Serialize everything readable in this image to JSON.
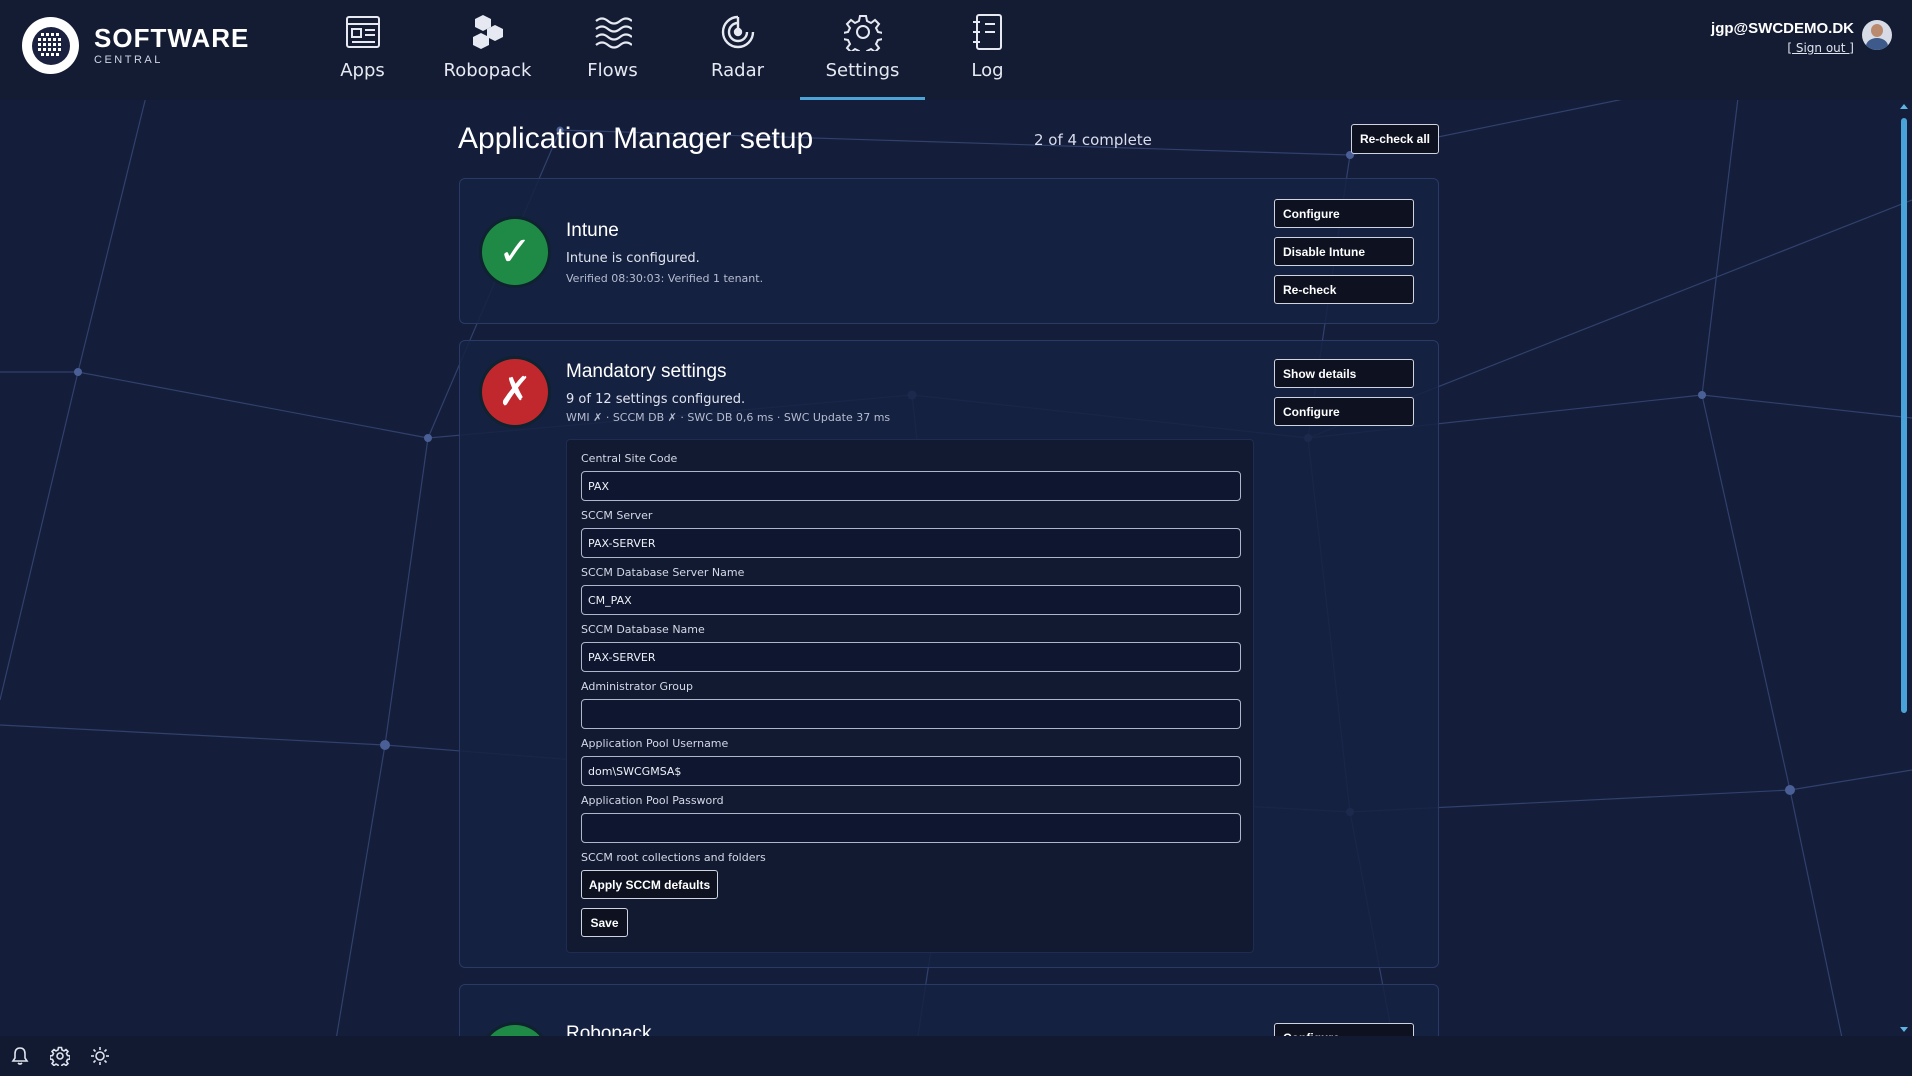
{
  "app": {
    "logo_word": "SOFTWARE",
    "logo_sub": "CENTRAL"
  },
  "nav": {
    "items": [
      {
        "label": "Apps",
        "icon": "apps-icon",
        "active": false
      },
      {
        "label": "Robopack",
        "icon": "robopack-icon",
        "active": false
      },
      {
        "label": "Flows",
        "icon": "flows-icon",
        "active": false
      },
      {
        "label": "Radar",
        "icon": "radar-icon",
        "active": false
      },
      {
        "label": "Settings",
        "icon": "gear-icon",
        "active": true
      },
      {
        "label": "Log",
        "icon": "log-icon",
        "active": false
      }
    ]
  },
  "user": {
    "email": "jgp@SWCDEMO.DK",
    "signout": "[ Sign out ]"
  },
  "page": {
    "title": "Application Manager setup",
    "progress": "2 of 4 complete",
    "recheck_all": "Re-check all"
  },
  "intune": {
    "title": "Intune",
    "status": "Intune is configured.",
    "detail": "Verified 08:30:03: Verified 1 tenant.",
    "state": "ok",
    "buttons": {
      "configure": "Configure",
      "disable": "Disable Intune",
      "recheck": "Re-check"
    }
  },
  "mandatory": {
    "title": "Mandatory settings",
    "status": "9 of 12 settings configured.",
    "detail": "WMI ✗ · SCCM DB ✗ · SWC DB 0,6 ms · SWC Update 37 ms",
    "state": "fail",
    "buttons": {
      "show_details": "Show details",
      "configure": "Configure"
    },
    "fields": {
      "central_site_code": {
        "label": "Central Site Code",
        "value": "PAX"
      },
      "sccm_server": {
        "label": "SCCM Server",
        "value": "PAX-SERVER"
      },
      "sccm_db_server": {
        "label": "SCCM Database Server Name",
        "value": "CM_PAX"
      },
      "sccm_db_name": {
        "label": "SCCM Database Name",
        "value": "PAX-SERVER"
      },
      "admin_group": {
        "label": "Administrator Group",
        "value": ""
      },
      "pool_username": {
        "label": "Application Pool Username",
        "value": "dom\\SWCGMSA$"
      },
      "pool_password": {
        "label": "Application Pool Password",
        "value": ""
      }
    },
    "root_collections_label": "SCCM root collections and folders",
    "apply_defaults": "Apply SCCM defaults",
    "save": "Save"
  },
  "robopack": {
    "title": "Robopack",
    "state": "ok",
    "buttons": {
      "configure": "Configure"
    }
  },
  "colors": {
    "background": "#141d3a",
    "topbar": "#141c33",
    "accent": "#4da3d6",
    "success": "#1f8a45",
    "error": "#c0282e"
  }
}
